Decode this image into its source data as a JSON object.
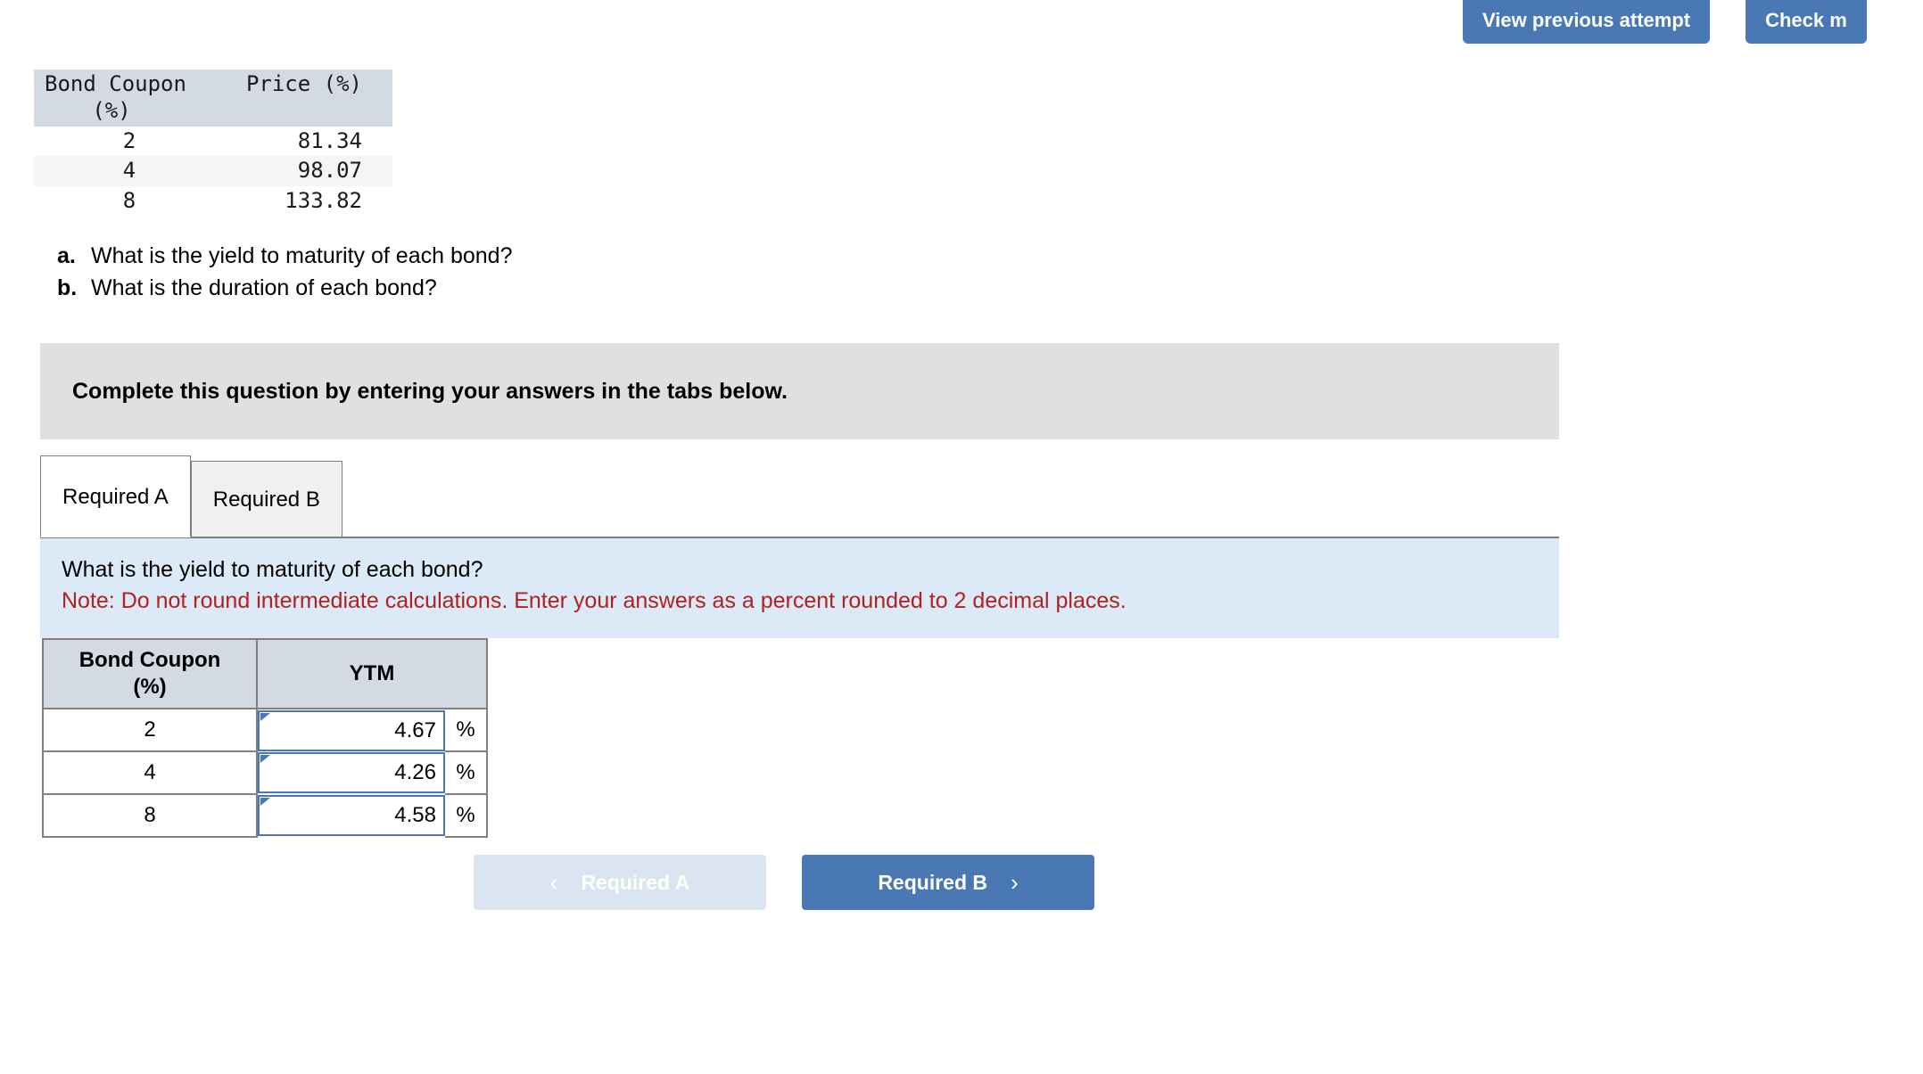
{
  "top_actions": [
    {
      "label": "View previous attempt",
      "name": "view-previous-attempt-button"
    },
    {
      "label": "Check m",
      "name": "check-my-work-button"
    }
  ],
  "source_table": {
    "headers": {
      "coupon_line1": "Bond Coupon",
      "coupon_line2": "(%)",
      "price": "Price (%)"
    },
    "rows": [
      {
        "coupon": "2",
        "price": "81.34"
      },
      {
        "coupon": "4",
        "price": "98.07"
      },
      {
        "coupon": "8",
        "price": "133.82"
      }
    ]
  },
  "questions": [
    {
      "letter": "a.",
      "text": "What is the yield to maturity of each bond?"
    },
    {
      "letter": "b.",
      "text": "What is the duration of each bond?"
    }
  ],
  "instruction_banner": {
    "text": "Complete this question by entering your answers in the tabs below."
  },
  "tabs": [
    {
      "label": "Required A",
      "active": true
    },
    {
      "label": "Required B",
      "active": false
    }
  ],
  "prompt": {
    "question": "What is the yield to maturity of each bond?",
    "note": "Note: Do not round intermediate calculations. Enter your answers as a percent rounded to 2 decimal places."
  },
  "answer_table": {
    "headers": {
      "coupon_line1": "Bond Coupon",
      "coupon_line2": "(%)",
      "ytm": "YTM"
    },
    "unit": "%",
    "rows": [
      {
        "coupon": "2",
        "ytm": "4.67"
      },
      {
        "coupon": "4",
        "ytm": "4.26"
      },
      {
        "coupon": "8",
        "ytm": "4.58"
      }
    ]
  },
  "nav": {
    "prev_label": "Required A",
    "prev_chevron": "‹",
    "next_label": "Required B",
    "next_chevron": "›"
  },
  "colors": {
    "accent_blue": "#4a78b5",
    "panel_blue": "#dce9f6",
    "panel_grey": "#e0e0e0",
    "table_header": "#d4dae4",
    "note_red": "#b02222"
  }
}
